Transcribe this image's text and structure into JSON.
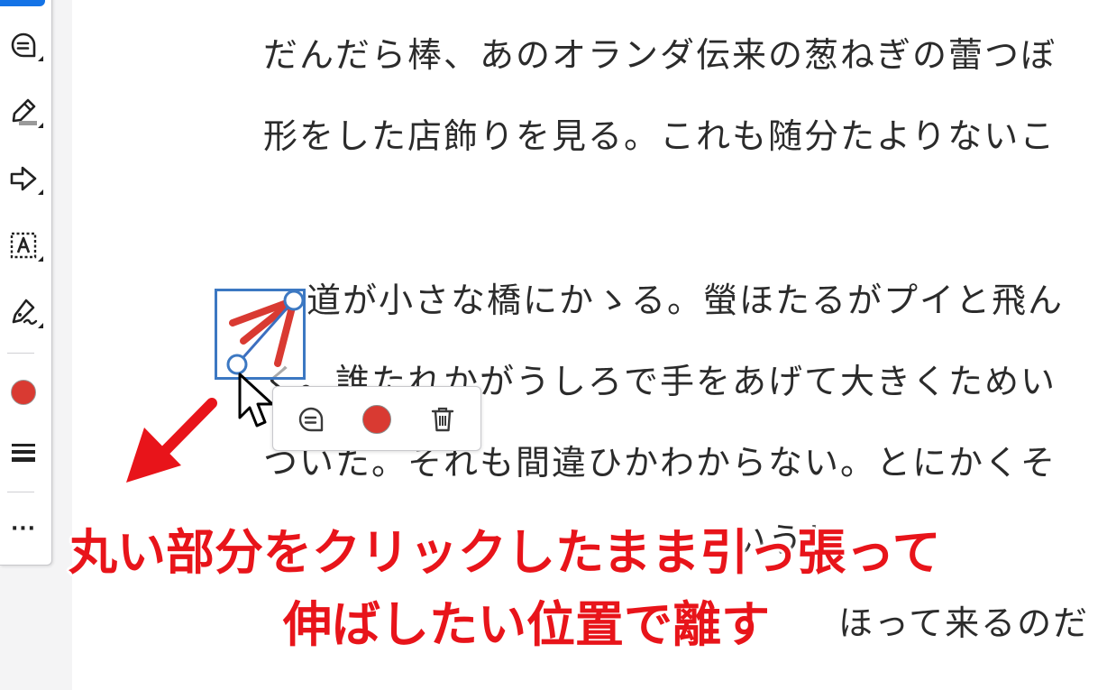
{
  "document": {
    "lines": [
      "だんだら棒、あのオランダ伝来の葱ねぎの蕾つぼ",
      "形をした店飾りを見る。これも随分たよりないこ",
      "道が小さな橋にかゝる。螢ほたるがプイと飛ん",
      "く。誰たれかがうしろで手をあげて大きくためい",
      "ついた。それも間違ひかわからない。とにかくそ",
      "　　　　　　　　　　　　　いうし",
      "ほって来るのだ"
    ]
  },
  "toolbar": {
    "tools": [
      "comment-tool",
      "highlight-tool",
      "arrow-tool",
      "text-box-tool",
      "draw-tool"
    ],
    "current_color": "#d93a32",
    "more_label": "···"
  },
  "popup": {
    "color": "#d93a32"
  },
  "callout": {
    "line1": "丸い部分をクリックしたまま引っ張って",
    "line2": "伸ばしたい位置で離す",
    "color": "#e8141a"
  },
  "colors": {
    "accent_blue": "#1473e6",
    "selection_blue": "#3c78c2",
    "ink_red": "#d93a32"
  }
}
